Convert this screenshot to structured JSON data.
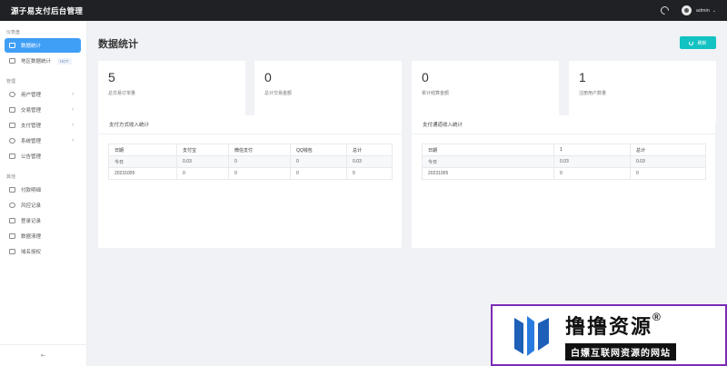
{
  "header": {
    "brand": "源子易支付后台管理",
    "username": "admin"
  },
  "sidebar": {
    "sections": [
      {
        "title": "仪表盘",
        "items": [
          {
            "label": "数据统计"
          },
          {
            "label": "地区数据统计",
            "badge": "HOT"
          }
        ]
      },
      {
        "title": "管理",
        "items": [
          {
            "label": "用户管理"
          },
          {
            "label": "交易管理"
          },
          {
            "label": "支付管理"
          },
          {
            "label": "系统管理"
          },
          {
            "label": "公告管理"
          }
        ]
      },
      {
        "title": "其他",
        "items": [
          {
            "label": "付款明细"
          },
          {
            "label": "风控记录"
          },
          {
            "label": "登录记录"
          },
          {
            "label": "数据清理"
          },
          {
            "label": "域名授权"
          }
        ]
      }
    ],
    "collapse_icon": "collapse-icon"
  },
  "main": {
    "title": "数据统计",
    "refresh_label": "刷新",
    "stats": [
      {
        "value": "5",
        "label": "总交易订单量"
      },
      {
        "value": "0",
        "label": "总计交易金额"
      },
      {
        "value": "0",
        "label": "累计结算金额"
      },
      {
        "value": "1",
        "label": "注册用户数量"
      }
    ],
    "panel_left": {
      "title": "支付方式收入统计",
      "columns": [
        "日期",
        "支付宝",
        "微信支付",
        "QQ钱包",
        "总计"
      ],
      "rows": [
        [
          "今日",
          "0.03",
          "0",
          "0",
          "0.03"
        ],
        [
          "20231005",
          "0",
          "0",
          "0",
          "0"
        ]
      ]
    },
    "panel_right": {
      "title": "支付通道收入统计",
      "columns": [
        "日期",
        "1",
        "总计"
      ],
      "rows": [
        [
          "今日",
          "0.03",
          "0.03"
        ],
        [
          "20231005",
          "0",
          "0"
        ]
      ]
    }
  },
  "watermark": {
    "title": "撸撸资源",
    "reg": "®",
    "subtitle": "白嫖互联网资源的网站"
  },
  "colors": {
    "accent": "#3f9ef5",
    "refresh": "#13c2c2",
    "topbar": "#1f2125"
  }
}
